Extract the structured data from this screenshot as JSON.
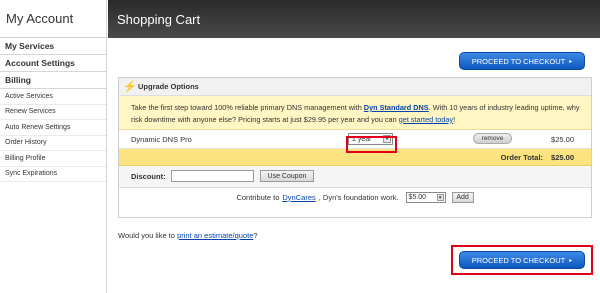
{
  "sidebar": {
    "title": "My Account",
    "sections": [
      "My Services",
      "Account Settings",
      "Billing"
    ],
    "billing_items": [
      "Active Services",
      "Renew Services",
      "Auto Renew Settings",
      "Order History",
      "Billing Profile",
      "Sync Expirations"
    ]
  },
  "header": {
    "title": "Shopping Cart"
  },
  "checkout": {
    "label": "PROCEED TO CHECKOUT",
    "arrow": "▸"
  },
  "upgrade": {
    "title": "Upgrade Options",
    "promo_prefix": "Take the first step toward 100% reliable primary DNS management with ",
    "promo_link": "Dyn Standard DNS",
    "promo_middle": ". With 10 years of industry leading uptime, why risk downtime with anyone else? Pricing starts at just $29.95 per year and you can ",
    "promo_link2": "get started today",
    "promo_suffix": "!"
  },
  "cart_item": {
    "name": "Dynamic DNS Pro",
    "term": "1 year",
    "remove_label": "remove",
    "price": "$25.00"
  },
  "total": {
    "label": "Order Total:",
    "value": "$25.00"
  },
  "discount": {
    "label": "Discount:",
    "value": "",
    "button": "Use Coupon"
  },
  "contribute": {
    "prefix": "Contribute to ",
    "link": "DynCares",
    "suffix": ", Dyn's foundation work.",
    "amount": "$5.00",
    "button": "Add"
  },
  "estimate": {
    "prefix": "Would you like to ",
    "link": "print an estimate/quote",
    "suffix": "?"
  },
  "colors": {
    "highlight": "#e0001a",
    "button_blue": "#1a63cf",
    "promo_bg": "#fff6c4",
    "total_bg": "#fbe37f"
  }
}
